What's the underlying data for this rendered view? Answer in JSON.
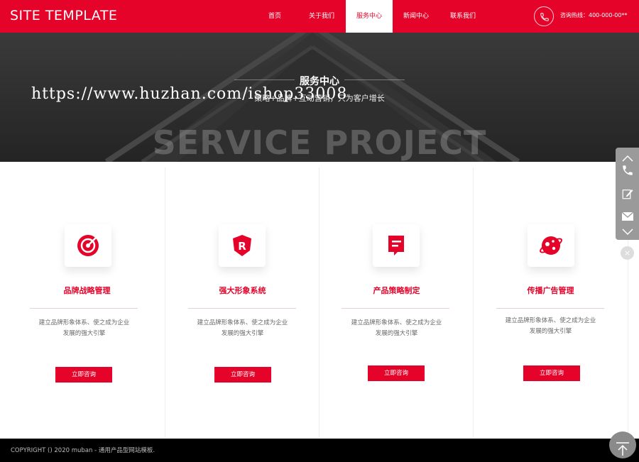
{
  "header": {
    "logo": "SITE TEMPLATE",
    "nav": [
      "首页",
      "关于我们",
      "服务中心",
      "新闻中心",
      "联系我们"
    ],
    "active_index": 2,
    "hotline": "咨询热线：400-000-00**"
  },
  "banner": {
    "title": "服务中心",
    "subtitle": "策略+品牌+互动营销，只为客户增长",
    "watermark": "SERVICE PROJECT",
    "url_overlay": "https://www.huzhan.com/ishop33008"
  },
  "services": [
    {
      "icon": "target-icon",
      "title": "品牌战略管理",
      "desc_line1": "建立品牌形象体系、使之成为企业",
      "desc_line2": "发展的强大引擎",
      "button": "立即咨询"
    },
    {
      "icon": "shield-r-icon",
      "title": "强大形象系统",
      "desc_line1": "建立品牌形象体系、使之成为企业",
      "desc_line2": "发展的强大引擎",
      "button": "立即咨询"
    },
    {
      "icon": "document-icon",
      "title": "产品策略制定",
      "desc_line1": "建立品牌形象体系、使之成为企业",
      "desc_line2": "发展的强大引擎",
      "button": "立即咨询"
    },
    {
      "icon": "planet-icon",
      "title": "传播广告管理",
      "desc_line1": "建立品牌形象体系、使之成为企业",
      "desc_line2": "发展的强大引擎",
      "button": "立即咨询"
    }
  ],
  "float_bar": {
    "items": [
      "chevron-up-icon",
      "phone-icon",
      "edit-icon",
      "mail-icon",
      "chevron-down-icon"
    ],
    "close": "×"
  },
  "footer": {
    "copyright": "COPYRIGHT () 2020 muban - 通用产品型网站模板."
  },
  "colors": {
    "brand": "#e5032a",
    "banner_bg": "#2b2b2b",
    "footer_bg": "#000000"
  }
}
